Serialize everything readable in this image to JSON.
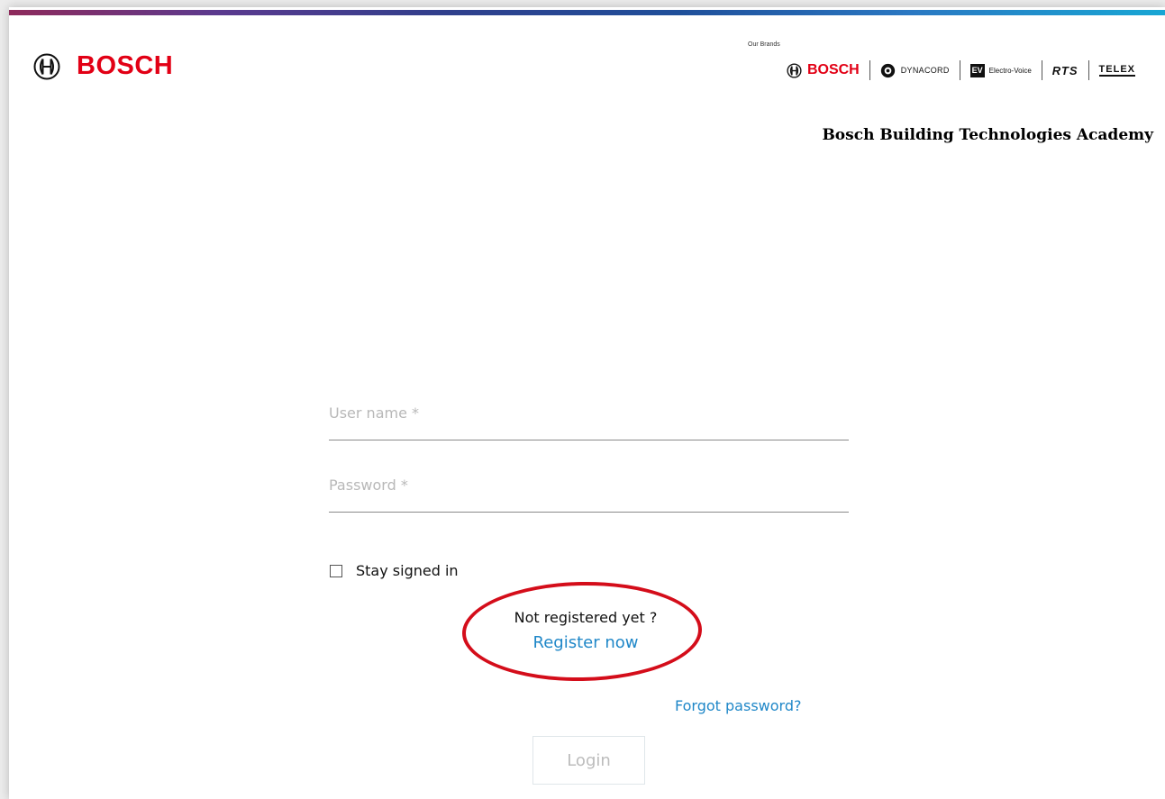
{
  "header": {
    "logo_text": "BOSCH",
    "brands_caption": "Our Brands",
    "brands": [
      "BOSCH",
      "DYNACORD",
      "Electro-Voice",
      "RTS",
      "TELEX"
    ],
    "ev_box_text": "EV",
    "academy_title": "Bosch Building Technologies Academy"
  },
  "form": {
    "username_placeholder": "User name *",
    "username_value": "",
    "password_placeholder": "Password *",
    "password_value": "",
    "stay_signed_in_label": "Stay signed in",
    "stay_signed_in_checked": false,
    "not_registered_text": "Not registered yet ?",
    "register_link": "Register now",
    "forgot_password_link": "Forgot password?",
    "login_button": "Login"
  },
  "colors": {
    "brand_red": "#e20015",
    "link_blue": "#1f87c8",
    "annotation_red": "#d40d1a"
  }
}
